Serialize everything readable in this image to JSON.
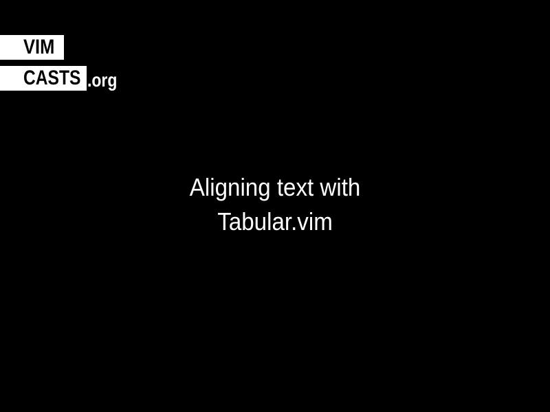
{
  "logo": {
    "line1": "VIM",
    "line2": "CASTS",
    "suffix": ".org"
  },
  "slide": {
    "title_line1": "Aligning text with",
    "title_line2": "Tabular.vim"
  },
  "colors": {
    "background": "#000000",
    "text": "#ffffff",
    "logo_block": "#ffffff",
    "logo_text": "#000000"
  }
}
